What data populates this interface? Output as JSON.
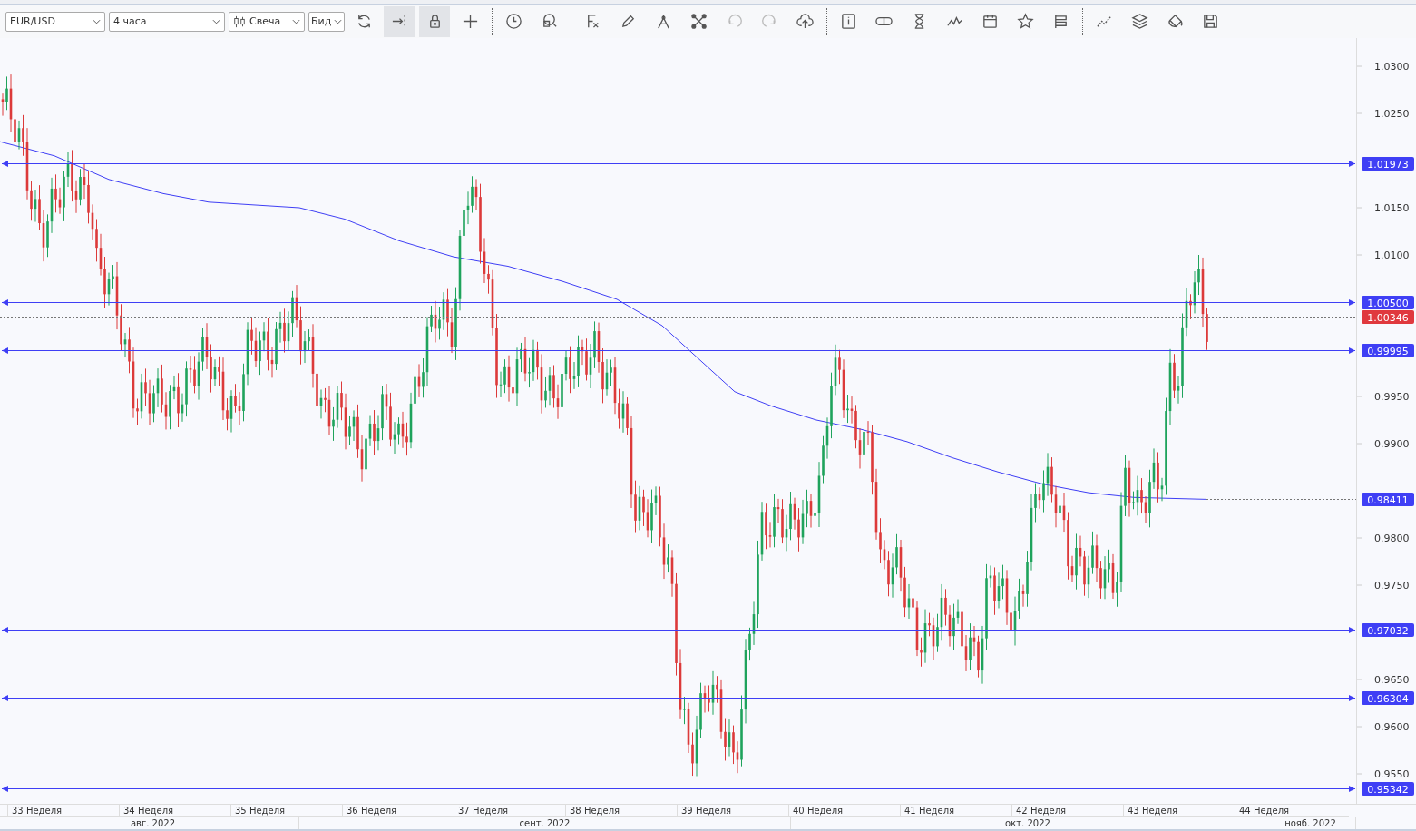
{
  "toolbar": {
    "symbol": "EUR/USD",
    "timeframe": "4 часа",
    "chart_type": "Свеча",
    "price_source": "Бид",
    "buttons": [
      {
        "kind": "refresh",
        "on": false
      },
      {
        "kind": "scroll-end",
        "on": true
      },
      {
        "kind": "lock",
        "on": true
      },
      {
        "kind": "crosshair",
        "on": false
      },
      {
        "kind": "sep"
      },
      {
        "kind": "clock",
        "on": false
      },
      {
        "kind": "zoom",
        "on": false
      },
      {
        "kind": "sep"
      },
      {
        "kind": "formula",
        "on": false
      },
      {
        "kind": "pencil",
        "on": false
      },
      {
        "kind": "compass",
        "on": false
      },
      {
        "kind": "network",
        "on": false
      },
      {
        "kind": "undo",
        "on": false
      },
      {
        "kind": "redo",
        "on": false
      },
      {
        "kind": "upload",
        "on": false
      },
      {
        "kind": "sep"
      },
      {
        "kind": "info",
        "on": false
      },
      {
        "kind": "toggle",
        "on": false
      },
      {
        "kind": "hourglass",
        "on": false
      },
      {
        "kind": "zigzag",
        "on": false
      },
      {
        "kind": "calendar",
        "on": false
      },
      {
        "kind": "star",
        "on": false
      },
      {
        "kind": "list",
        "on": false
      },
      {
        "kind": "sep"
      },
      {
        "kind": "trend",
        "on": false
      },
      {
        "kind": "layers",
        "on": false
      },
      {
        "kind": "bucket",
        "on": false
      },
      {
        "kind": "save",
        "on": false
      }
    ]
  },
  "price_axis": {
    "ticks": [
      "1.0300",
      "1.0250",
      "1.0150",
      "1.0100",
      "0.9950",
      "0.9900",
      "0.9800",
      "0.9750",
      "0.9650",
      "0.9600",
      "0.9550"
    ],
    "levels": [
      {
        "label": "1.01973",
        "kind": "line"
      },
      {
        "label": "1.00500",
        "kind": "line"
      },
      {
        "label": "1.00346",
        "kind": "current"
      },
      {
        "label": "0.99995",
        "kind": "line"
      },
      {
        "label": "0.98411",
        "kind": "ma"
      },
      {
        "label": "0.97032",
        "kind": "line"
      },
      {
        "label": "0.96304",
        "kind": "line"
      },
      {
        "label": "0.95342",
        "kind": "line"
      }
    ]
  },
  "time_axis": {
    "weeks": [
      "33 Неделя",
      "34 Неделя",
      "35 Неделя",
      "36 Неделя",
      "37 Неделя",
      "38 Неделя",
      "39 Неделя",
      "40 Неделя",
      "41 Неделя",
      "42 Неделя",
      "43 Неделя",
      "44 Неделя"
    ],
    "months": [
      "авг. 2022",
      "сент. 2022",
      "окт. 2022",
      "нояб. 2022"
    ]
  }
}
